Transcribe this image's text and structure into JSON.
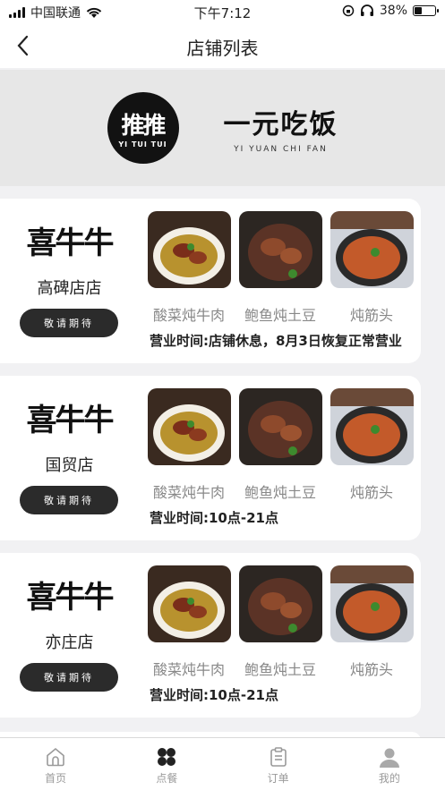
{
  "status_bar": {
    "carrier": "中国联通",
    "time": "下午7:12",
    "battery": "38%",
    "battery_level": 0.38
  },
  "nav": {
    "title": "店铺列表"
  },
  "banner": {
    "logo_text": "推推",
    "logo_sub": "YI TUI TUI",
    "brand_cn": "一元吃饭",
    "brand_en": "YI YUAN CHI FAN"
  },
  "stores": [
    {
      "logo": "喜牛牛",
      "name": "高碑店店",
      "button": "敬请期待",
      "dishes": [
        "酸菜炖牛肉",
        "鲍鱼炖土豆",
        "炖筋头"
      ],
      "hours": "营业时间:店铺休息，8月3日恢复正常营业"
    },
    {
      "logo": "喜牛牛",
      "name": "国贸店",
      "button": "敬请期待",
      "dishes": [
        "酸菜炖牛肉",
        "鲍鱼炖土豆",
        "炖筋头"
      ],
      "hours": "营业时间:10点-21点"
    },
    {
      "logo": "喜牛牛",
      "name": "亦庄店",
      "button": "敬请期待",
      "dishes": [
        "酸菜炖牛肉",
        "鲍鱼炖土豆",
        "炖筋头"
      ],
      "hours": "营业时间:10点-21点"
    }
  ],
  "tabs": [
    {
      "label": "首页",
      "icon": "home-icon"
    },
    {
      "label": "点餐",
      "icon": "order-food-icon"
    },
    {
      "label": "订单",
      "icon": "clipboard-icon"
    },
    {
      "label": "我的",
      "icon": "user-icon"
    }
  ],
  "active_tab": "点餐"
}
